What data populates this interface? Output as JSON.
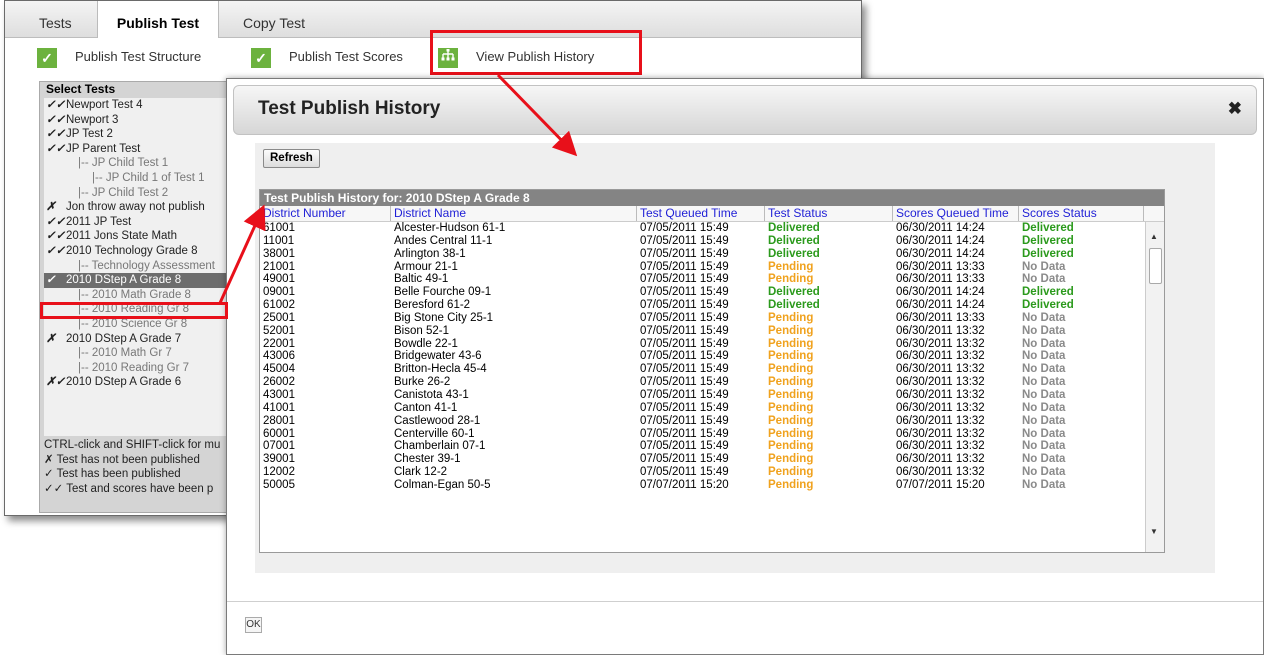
{
  "tabs": [
    "Tests",
    "Publish Test",
    "Copy Test"
  ],
  "subnav": {
    "structure": "Publish Test Structure",
    "scores": "Publish Test Scores",
    "history": "View Publish History"
  },
  "select_panel": {
    "title": "Select Tests",
    "items": [
      {
        "mark": "✓✓",
        "label": "Newport Test 4",
        "indent": 0
      },
      {
        "mark": "✓✓",
        "label": "Newport 3",
        "indent": 0
      },
      {
        "mark": "✓✓",
        "label": "JP Test 2",
        "indent": 0
      },
      {
        "mark": "✓✓",
        "label": "JP Parent Test",
        "indent": 0
      },
      {
        "mark": "",
        "label": "|-- JP Child Test 1",
        "indent": 1
      },
      {
        "mark": "",
        "label": "|-- JP Child 1 of Test 1",
        "indent": 2
      },
      {
        "mark": "",
        "label": "|-- JP Child Test 2",
        "indent": 1
      },
      {
        "mark": "✗",
        "label": "Jon throw away not publish",
        "indent": 0
      },
      {
        "mark": "✓✓",
        "label": "2011 JP Test",
        "indent": 0
      },
      {
        "mark": "✓✓",
        "label": "2011 Jons State Math",
        "indent": 0
      },
      {
        "mark": "✓✓",
        "label": "2010 Technology Grade 8",
        "indent": 0
      },
      {
        "mark": "",
        "label": "|-- Technology Assessment",
        "indent": 1
      },
      {
        "mark": "✓",
        "label": "2010 DStep A Grade 8",
        "indent": 0,
        "selected": true
      },
      {
        "mark": "",
        "label": "|-- 2010 Math Grade 8",
        "indent": 1
      },
      {
        "mark": "",
        "label": "|-- 2010 Reading Gr 8",
        "indent": 1
      },
      {
        "mark": "",
        "label": "|-- 2010 Science Gr 8",
        "indent": 1
      },
      {
        "mark": "✗",
        "label": "2010 DStep A Grade 7",
        "indent": 0
      },
      {
        "mark": "",
        "label": "|-- 2010 Math Gr 7",
        "indent": 1
      },
      {
        "mark": "",
        "label": "|-- 2010 Reading Gr 7",
        "indent": 1
      },
      {
        "mark": "✗✓",
        "label": "2010 DStep A Grade 6",
        "indent": 0
      }
    ],
    "legend": [
      "CTRL-click and SHIFT-click for mu",
      "✗ Test has not been published",
      "✓ Test has been published",
      "✓✓ Test and scores have been p"
    ]
  },
  "dialog": {
    "title": "Test Publish History",
    "refresh_label": "Refresh",
    "ok_label": "OK",
    "grid_caption": "Test Publish History for: 2010 DStep A Grade 8",
    "columns": [
      "District Number",
      "District Name",
      "Test Queued Time",
      "Test Status",
      "Scores Queued Time",
      "Scores Status"
    ],
    "rows": [
      [
        "61001",
        "Alcester-Hudson 61-1",
        "07/05/2011 15:49",
        "Delivered",
        "06/30/2011 14:24",
        "Delivered"
      ],
      [
        "11001",
        "Andes Central 11-1",
        "07/05/2011 15:49",
        "Delivered",
        "06/30/2011 14:24",
        "Delivered"
      ],
      [
        "38001",
        "Arlington 38-1",
        "07/05/2011 15:49",
        "Delivered",
        "06/30/2011 14:24",
        "Delivered"
      ],
      [
        "21001",
        "Armour 21-1",
        "07/05/2011 15:49",
        "Pending",
        "06/30/2011 13:33",
        "No Data"
      ],
      [
        "49001",
        "Baltic 49-1",
        "07/05/2011 15:49",
        "Pending",
        "06/30/2011 13:33",
        "No Data"
      ],
      [
        "09001",
        "Belle Fourche 09-1",
        "07/05/2011 15:49",
        "Delivered",
        "06/30/2011 14:24",
        "Delivered"
      ],
      [
        "61002",
        "Beresford 61-2",
        "07/05/2011 15:49",
        "Delivered",
        "06/30/2011 14:24",
        "Delivered"
      ],
      [
        "25001",
        "Big Stone City 25-1",
        "07/05/2011 15:49",
        "Pending",
        "06/30/2011 13:33",
        "No Data"
      ],
      [
        "52001",
        "Bison 52-1",
        "07/05/2011 15:49",
        "Pending",
        "06/30/2011 13:32",
        "No Data"
      ],
      [
        "22001",
        "Bowdle 22-1",
        "07/05/2011 15:49",
        "Pending",
        "06/30/2011 13:32",
        "No Data"
      ],
      [
        "43006",
        "Bridgewater 43-6",
        "07/05/2011 15:49",
        "Pending",
        "06/30/2011 13:32",
        "No Data"
      ],
      [
        "45004",
        "Britton-Hecla 45-4",
        "07/05/2011 15:49",
        "Pending",
        "06/30/2011 13:32",
        "No Data"
      ],
      [
        "26002",
        "Burke 26-2",
        "07/05/2011 15:49",
        "Pending",
        "06/30/2011 13:32",
        "No Data"
      ],
      [
        "43001",
        "Canistota 43-1",
        "07/05/2011 15:49",
        "Pending",
        "06/30/2011 13:32",
        "No Data"
      ],
      [
        "41001",
        "Canton 41-1",
        "07/05/2011 15:49",
        "Pending",
        "06/30/2011 13:32",
        "No Data"
      ],
      [
        "28001",
        "Castlewood 28-1",
        "07/05/2011 15:49",
        "Pending",
        "06/30/2011 13:32",
        "No Data"
      ],
      [
        "60001",
        "Centerville 60-1",
        "07/05/2011 15:49",
        "Pending",
        "06/30/2011 13:32",
        "No Data"
      ],
      [
        "07001",
        "Chamberlain 07-1",
        "07/05/2011 15:49",
        "Pending",
        "06/30/2011 13:32",
        "No Data"
      ],
      [
        "39001",
        "Chester 39-1",
        "07/05/2011 15:49",
        "Pending",
        "06/30/2011 13:32",
        "No Data"
      ],
      [
        "12002",
        "Clark 12-2",
        "07/05/2011 15:49",
        "Pending",
        "06/30/2011 13:32",
        "No Data"
      ],
      [
        "50005",
        "Colman-Egan 50-5",
        "07/07/2011 15:20",
        "Pending",
        "07/07/2011 15:20",
        "No Data"
      ]
    ]
  },
  "colors": {
    "accent_green": "#6cb23e",
    "delivered": "#2b9a1c",
    "pending": "#f0a21e",
    "no_data": "#8a8a8a",
    "link_blue": "#1f1fd6",
    "highlight_red": "#e8101a"
  },
  "icons": {
    "check": "check-icon",
    "tree": "tree-icon",
    "close": "close-icon"
  }
}
